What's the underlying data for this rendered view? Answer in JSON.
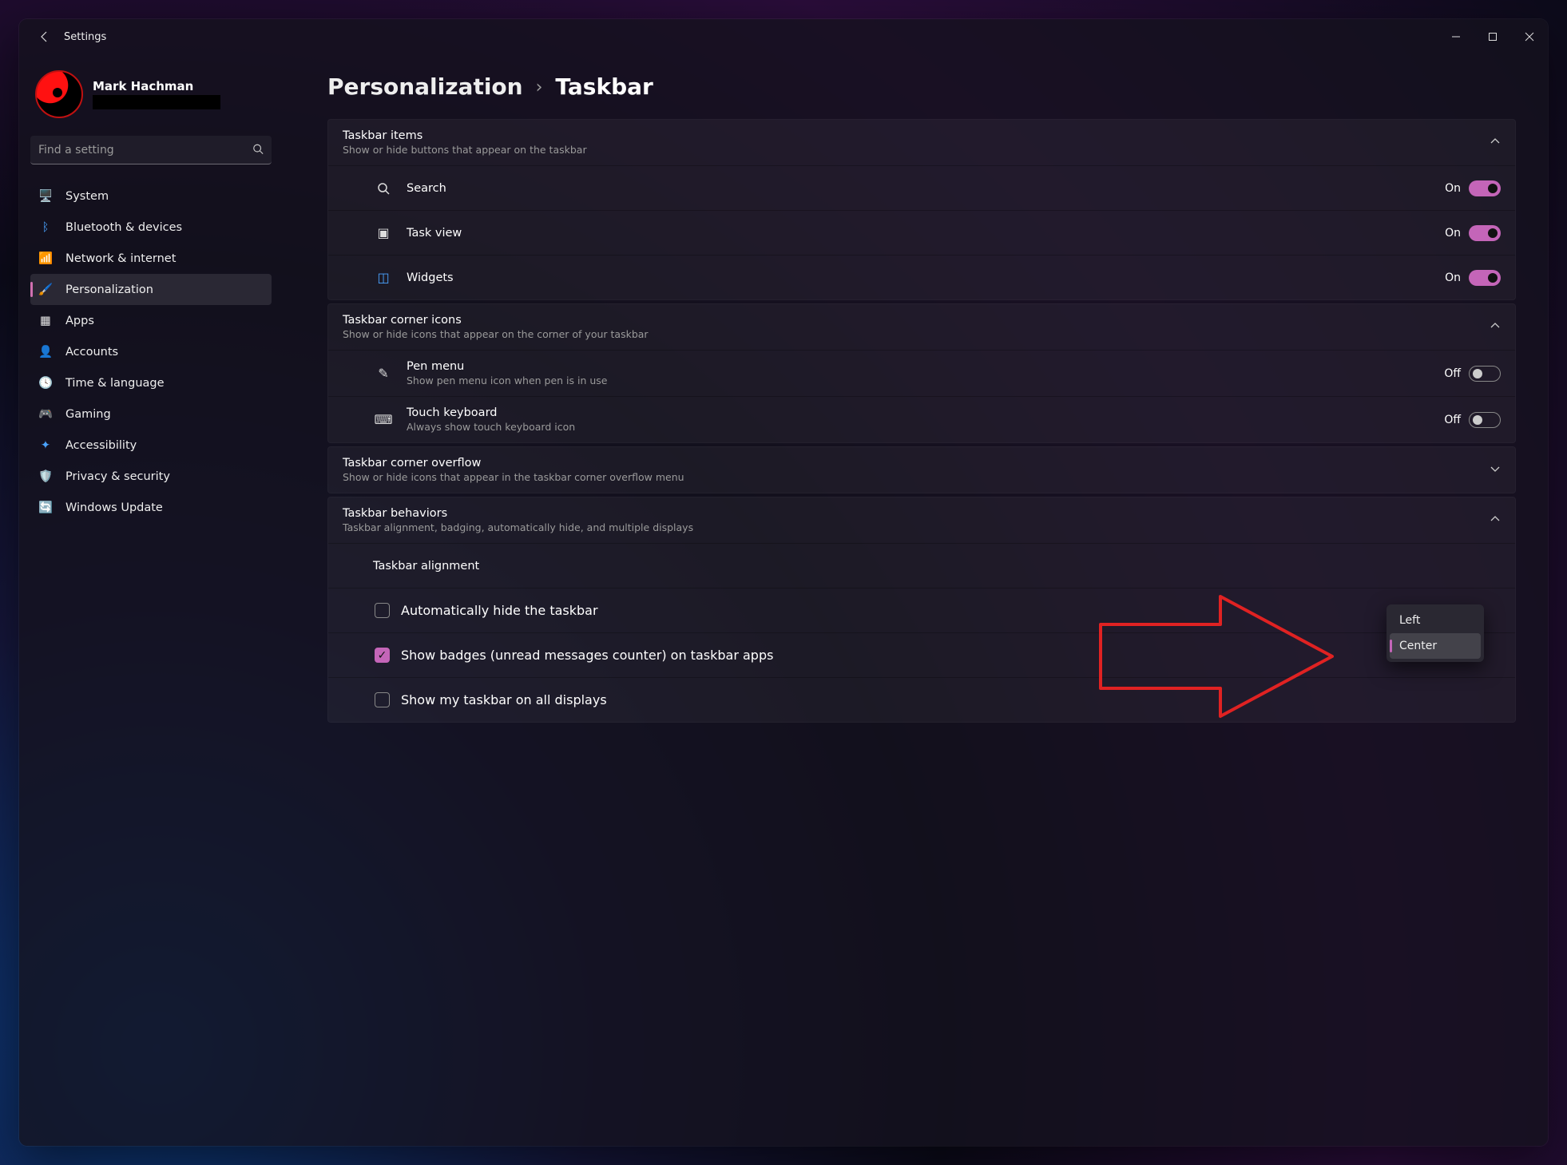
{
  "app_title": "Settings",
  "user": {
    "name": "Mark Hachman"
  },
  "search": {
    "placeholder": "Find a setting"
  },
  "sidebar": {
    "items": [
      {
        "label": "System"
      },
      {
        "label": "Bluetooth & devices"
      },
      {
        "label": "Network & internet"
      },
      {
        "label": "Personalization"
      },
      {
        "label": "Apps"
      },
      {
        "label": "Accounts"
      },
      {
        "label": "Time & language"
      },
      {
        "label": "Gaming"
      },
      {
        "label": "Accessibility"
      },
      {
        "label": "Privacy & security"
      },
      {
        "label": "Windows Update"
      }
    ]
  },
  "breadcrumb": {
    "parent": "Personalization",
    "current": "Taskbar"
  },
  "sections": {
    "taskbar_items": {
      "title": "Taskbar items",
      "subtitle": "Show or hide buttons that appear on the taskbar",
      "rows": [
        {
          "label": "Search",
          "state": "On"
        },
        {
          "label": "Task view",
          "state": "On"
        },
        {
          "label": "Widgets",
          "state": "On"
        }
      ]
    },
    "corner_icons": {
      "title": "Taskbar corner icons",
      "subtitle": "Show or hide icons that appear on the corner of your taskbar",
      "rows": [
        {
          "label": "Pen menu",
          "sub": "Show pen menu icon when pen is in use",
          "state": "Off"
        },
        {
          "label": "Touch keyboard",
          "sub": "Always show touch keyboard icon",
          "state": "Off"
        }
      ]
    },
    "corner_overflow": {
      "title": "Taskbar corner overflow",
      "subtitle": "Show or hide icons that appear in the taskbar corner overflow menu"
    },
    "behaviors": {
      "title": "Taskbar behaviors",
      "subtitle": "Taskbar alignment, badging, automatically hide, and multiple displays",
      "alignment_label": "Taskbar alignment",
      "alignment_options": {
        "left": "Left",
        "center": "Center"
      },
      "cb1": "Automatically hide the taskbar",
      "cb2": "Show badges (unread messages counter) on taskbar apps",
      "cb3": "Show my taskbar on all displays"
    }
  },
  "toggle_labels": {
    "on": "On",
    "off": "Off"
  }
}
